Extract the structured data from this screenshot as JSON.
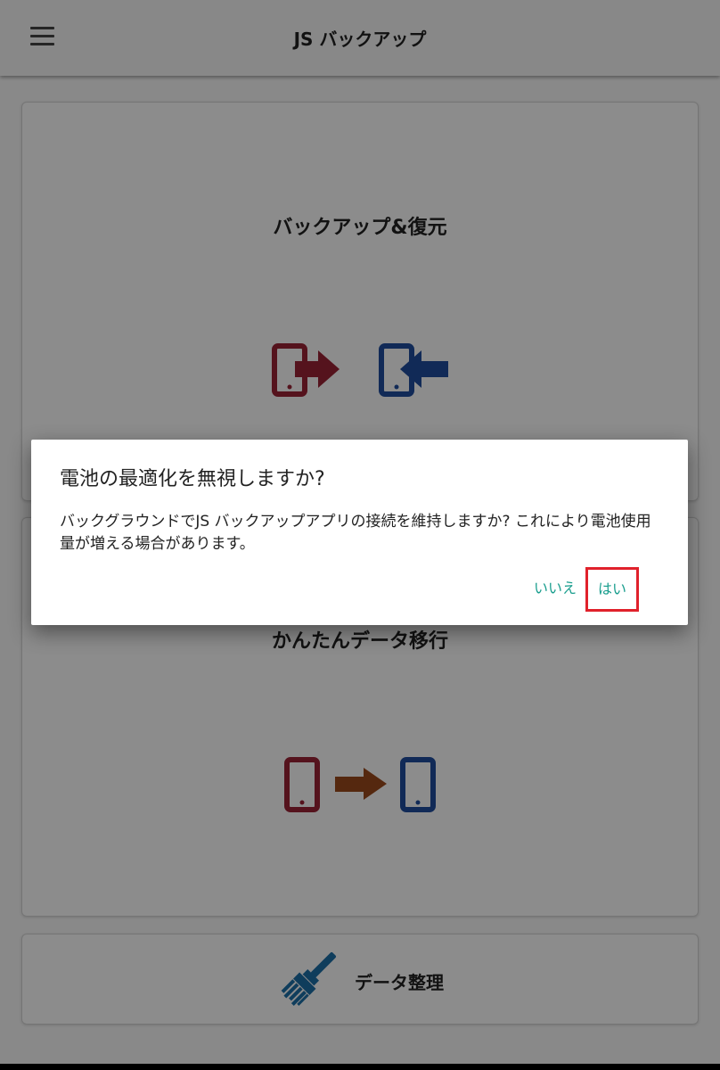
{
  "appbar": {
    "title": "JS バックアップ",
    "menu_icon": "hamburger-menu-icon"
  },
  "cards": {
    "backup_restore": {
      "title": "バックアップ&復元",
      "icons": [
        "phone-export-icon",
        "phone-import-icon"
      ]
    },
    "easy_transfer": {
      "title": "かんたんデータ移行",
      "icons": [
        "phone-source-icon",
        "arrow-right-icon",
        "phone-target-icon"
      ]
    },
    "data_cleanup": {
      "label": "データ整理",
      "icon": "brush-icon"
    }
  },
  "dialog": {
    "title": "電池の最適化を無視しますか?",
    "message": "バックグラウンドでJS バックアップアプリの接続を維持しますか? これにより電池使用量が増える場合があります。",
    "no_label": "いいえ",
    "yes_label": "はい"
  },
  "colors": {
    "accent": "#1a9e8e",
    "export_red": "#9b2335",
    "import_blue": "#1f4e9e",
    "transfer_orange": "#9b4a1d",
    "highlight": "#e0212b"
  }
}
